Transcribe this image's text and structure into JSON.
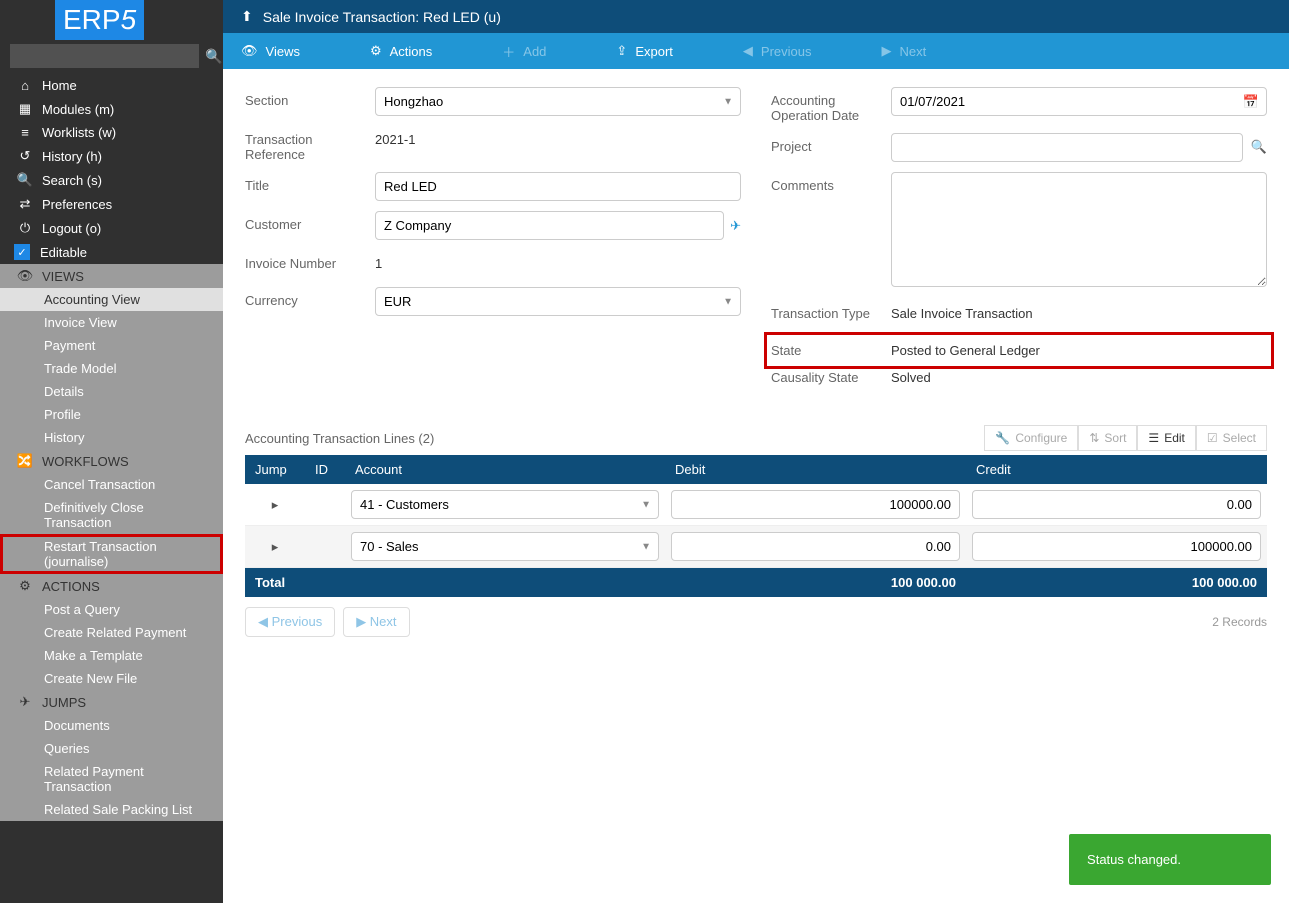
{
  "logo": "ERP5",
  "sidebar": {
    "search_placeholder": "",
    "nav": [
      {
        "icon": "⌂",
        "label": "Home"
      },
      {
        "icon": "▦",
        "label": "Modules (m)"
      },
      {
        "icon": "≡",
        "label": "Worklists (w)"
      },
      {
        "icon": "↺",
        "label": "History (h)"
      },
      {
        "icon": "🔍",
        "label": "Search (s)"
      },
      {
        "icon": "⇄",
        "label": "Preferences"
      },
      {
        "icon": "⏻",
        "label": "Logout (o)"
      }
    ],
    "editable": "Editable",
    "views_header": "VIEWS",
    "views": [
      "Accounting View",
      "Invoice View",
      "Payment",
      "Trade Model",
      "Details",
      "Profile",
      "History"
    ],
    "workflows_header": "WORKFLOWS",
    "workflows": [
      "Cancel Transaction",
      "Definitively Close Transaction",
      "Restart Transaction (journalise)"
    ],
    "actions_header": "ACTIONS",
    "actions": [
      "Post a Query",
      "Create Related Payment",
      "Make a Template",
      "Create New File"
    ],
    "jumps_header": "JUMPS",
    "jumps": [
      "Documents",
      "Queries",
      "Related Payment Transaction",
      "Related Sale Packing List"
    ]
  },
  "header": {
    "title": "Sale Invoice Transaction: Red LED (u)"
  },
  "toolbar": {
    "views": "Views",
    "actions": "Actions",
    "add": "Add",
    "export": "Export",
    "previous": "Previous",
    "next": "Next"
  },
  "form": {
    "section_label": "Section",
    "section_value": "Hongzhao",
    "ref_label": "Transaction Reference",
    "ref_value": "2021-1",
    "title_label": "Title",
    "title_value": "Red LED",
    "customer_label": "Customer",
    "customer_value": "Z Company",
    "invoice_label": "Invoice Number",
    "invoice_value": "1",
    "currency_label": "Currency",
    "currency_value": "EUR",
    "date_label": "Accounting Operation Date",
    "date_value": "01/07/2021",
    "project_label": "Project",
    "project_value": "",
    "comments_label": "Comments",
    "comments_value": "",
    "tx_type_label": "Transaction Type",
    "tx_type_value": "Sale Invoice Transaction",
    "state_label": "State",
    "state_value": "Posted to General Ledger",
    "causality_label": "Causality State",
    "causality_value": "Solved"
  },
  "lines": {
    "title": "Accounting Transaction Lines (2)",
    "tools": {
      "configure": "Configure",
      "sort": "Sort",
      "edit": "Edit",
      "select": "Select"
    },
    "cols": {
      "jump": "Jump",
      "id": "ID",
      "account": "Account",
      "debit": "Debit",
      "credit": "Credit"
    },
    "rows": [
      {
        "account": "41 - Customers",
        "debit": "100000.00",
        "credit": "0.00"
      },
      {
        "account": "70 - Sales",
        "debit": "0.00",
        "credit": "100000.00"
      }
    ],
    "total_label": "Total",
    "total_debit": "100 000.00",
    "total_credit": "100 000.00",
    "prev": "Previous",
    "next": "Next",
    "records": "2 Records"
  },
  "toast": "Status changed."
}
